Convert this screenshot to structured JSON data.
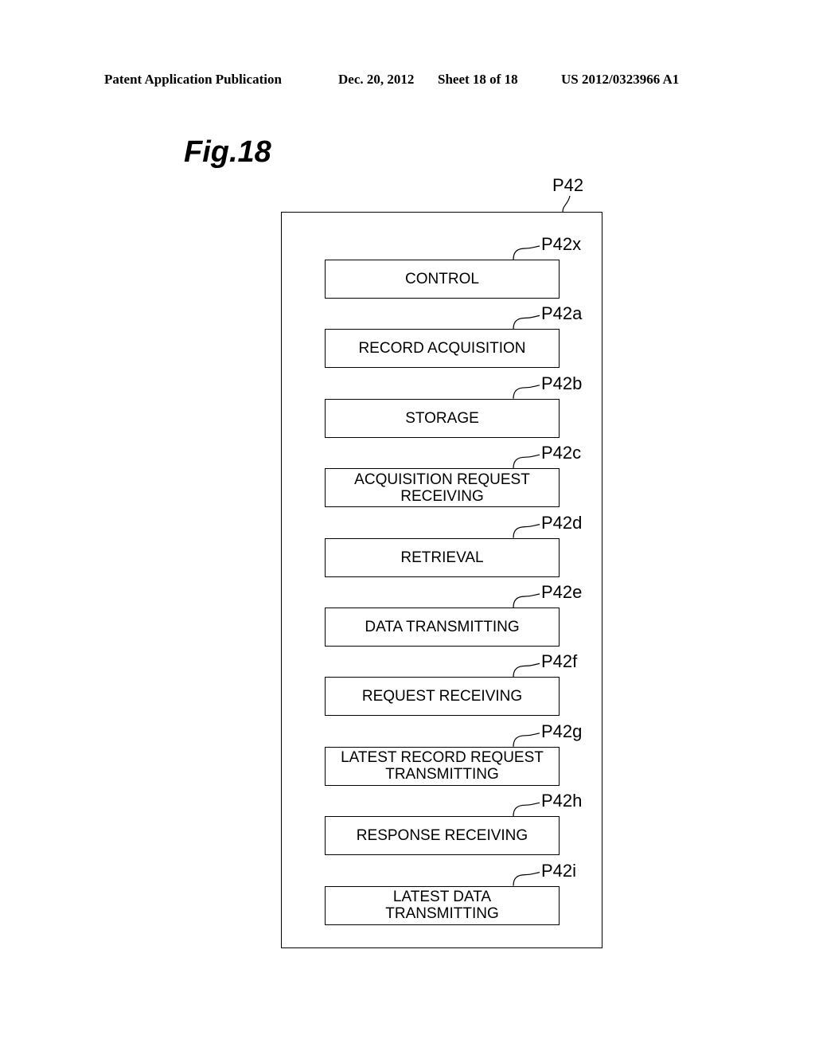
{
  "header": {
    "publication": "Patent Application Publication",
    "date": "Dec. 20, 2012",
    "sheet": "Sheet 18 of 18",
    "number": "US 2012/0323966 A1"
  },
  "figure": {
    "title": "Fig.18",
    "outer_label": "P42",
    "modules": [
      {
        "ref": "P42x",
        "label": "CONTROL"
      },
      {
        "ref": "P42a",
        "label": "RECORD ACQUISITION"
      },
      {
        "ref": "P42b",
        "label": "STORAGE"
      },
      {
        "ref": "P42c",
        "label": "ACQUISITION REQUEST\nRECEIVING"
      },
      {
        "ref": "P42d",
        "label": "RETRIEVAL"
      },
      {
        "ref": "P42e",
        "label": "DATA TRANSMITTING"
      },
      {
        "ref": "P42f",
        "label": "REQUEST RECEIVING"
      },
      {
        "ref": "P42g",
        "label": "LATEST RECORD REQUEST\nTRANSMITTING"
      },
      {
        "ref": "P42h",
        "label": "RESPONSE RECEIVING"
      },
      {
        "ref": "P42i",
        "label": "LATEST DATA\nTRANSMITTING"
      }
    ]
  }
}
